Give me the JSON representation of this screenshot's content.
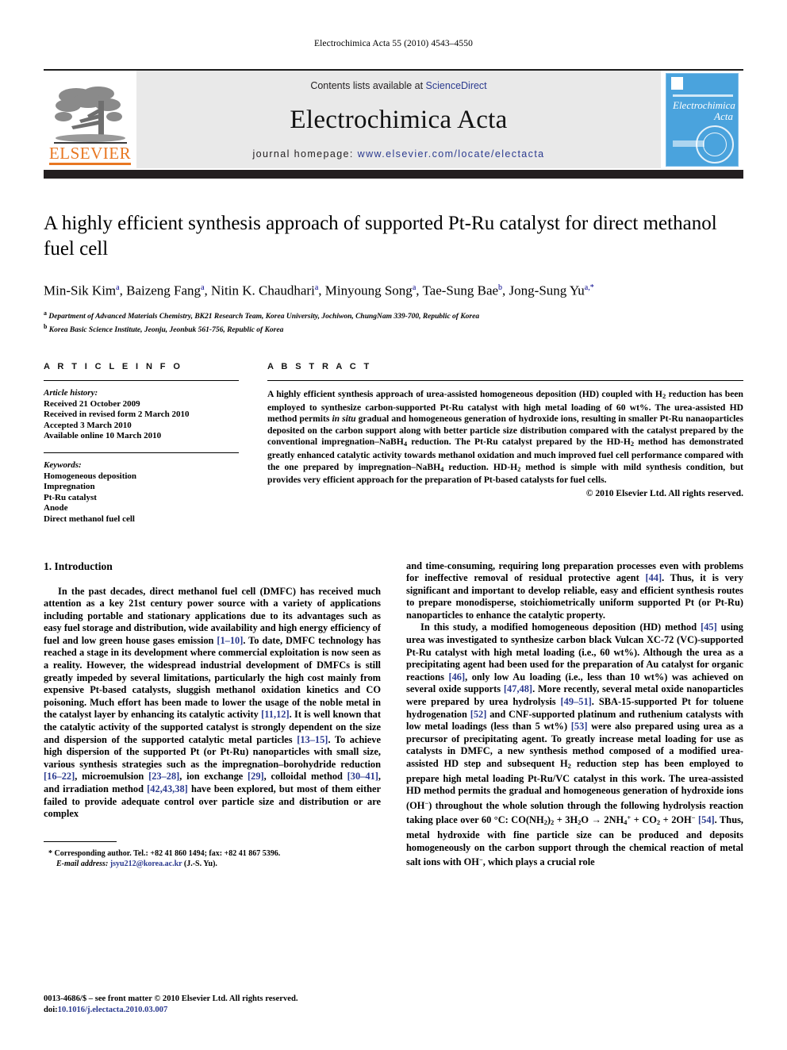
{
  "running_head": "Electrochimica Acta 55 (2010) 4543–4550",
  "masthead": {
    "contents_prefix": "Contents lists available at ",
    "contents_link": "ScienceDirect",
    "journal_name": "Electrochimica Acta",
    "homepage_prefix": "journal homepage:",
    "homepage_url": "www.elsevier.com/locate/electacta",
    "publisher_wordmark": "ELSEVIER",
    "cover_title_line1": "Electrochimica",
    "cover_title_line2": "Acta",
    "link_color": "#2b3a8f",
    "elsevier_orange": "#E87722",
    "cover_blue": "#4aa3dd",
    "band_color": "#231f20",
    "masthead_bg": "#e9e9e9"
  },
  "article": {
    "title": "A highly efficient synthesis approach of supported Pt-Ru catalyst for direct methanol fuel cell",
    "authors_html": "Min-Sik Kim<sup>a</sup>, Baizeng Fang<sup>a</sup>, Nitin K. Chaudhari<sup>a</sup>, Minyoung Song<sup>a</sup>, Tae-Sung Bae<sup>b</sup>, Jong-Sung Yu<sup>a,<span class=\"star\">*</span></sup>",
    "affiliation_a": "Department of Advanced Materials Chemistry, BK21 Research Team, Korea University, Jochiwon, ChungNam 339-700, Republic of Korea",
    "affiliation_b": "Korea Basic Science Institute, Jeonju, Jeonbuk 561-756, Republic of Korea",
    "affil_marker_a": "a",
    "affil_marker_b": "b"
  },
  "article_info": {
    "heading": "A R T I C L E    I N F O",
    "history_label": "Article history:",
    "history": [
      "Received 21 October 2009",
      "Received in revised form 2 March 2010",
      "Accepted 3 March 2010",
      "Available online 10 March 2010"
    ],
    "keywords_label": "Keywords:",
    "keywords": [
      "Homogeneous deposition",
      "Impregnation",
      "Pt-Ru catalyst",
      "Anode",
      "Direct methanol fuel cell"
    ]
  },
  "abstract": {
    "heading": "A B S T R A C T",
    "text_html": "A highly efficient synthesis approach of urea-assisted homogeneous deposition (HD) coupled with H<span class=\"sub\">2</span> reduction has been employed to synthesize carbon-supported Pt-Ru catalyst with high metal loading of 60 wt%. The urea-assisted HD method permits <em>in situ</em> gradual and homogeneous generation of hydroxide ions, resulting in smaller Pt-Ru nanaoparticles deposited on the carbon support along with better particle size distribution compared with the catalyst prepared by the conventional impregnation–NaBH<span class=\"sub\">4</span> reduction. The Pt-Ru catalyst prepared by the HD-H<span class=\"sub\">2</span> method has demonstrated greatly enhanced catalytic activity towards methanol oxidation and much improved fuel cell performance compared with the one prepared by impregnation–NaBH<span class=\"sub\">4</span> reduction. HD-H<span class=\"sub\">2</span> method is simple with mild synthesis condition, but provides very efficient approach for the preparation of Pt-based catalysts for fuel cells.",
    "copyright": "© 2010 Elsevier Ltd. All rights reserved."
  },
  "body": {
    "section_number_title": "1.  Introduction",
    "left_paragraphs_html": [
      "In the past decades, direct methanol fuel cell (DMFC) has received much attention as a key 21st century power source with a variety of applications including portable and stationary applications due to its advantages such as easy fuel storage and distribution, wide availability and high energy efficiency of fuel and low green house gases emission <span class=\"cite\">[1–10]</span>. To date, DMFC technology has reached a stage in its development where commercial exploitation is now seen as a reality. However, the widespread industrial development of DMFCs is still greatly impeded by several limitations, particularly the high cost mainly from expensive Pt-based catalysts, sluggish methanol oxidation kinetics and CO poisoning. Much effort has been made to lower the usage of the noble metal in the catalyst layer by enhancing its catalytic activity <span class=\"cite\">[11,12]</span>. It is well known that the catalytic activity of the supported catalyst is strongly dependent on the size and dispersion of the supported catalytic metal particles <span class=\"cite\">[13–15]</span>. To achieve high dispersion of the supported Pt (or Pt-Ru) nanoparticles with small size, various synthesis strategies such as the impregnation–borohydride reduction <span class=\"cite\">[16–22]</span>, microemulsion <span class=\"cite\">[23–28]</span>, ion exchange <span class=\"cite\">[29]</span>, colloidal method <span class=\"cite\">[30–41]</span>, and irradiation method <span class=\"cite\">[42,43,38]</span> have been explored, but most of them either failed to provide adequate control over particle size and distribution or are complex"
    ],
    "right_paragraphs_html": [
      "and time-consuming, requiring long preparation processes even with problems for ineffective removal of residual protective agent <span class=\"cite\">[44]</span>. Thus, it is very significant and important to develop reliable, easy and efficient synthesis routes to prepare monodisperse, stoichiometrically uniform supported Pt (or Pt-Ru) nanoparticles to enhance the catalytic property.",
      "In this study, a modified homogeneous deposition (HD) method <span class=\"cite\">[45]</span> using urea was investigated to synthesize carbon black Vulcan XC-72 (VC)-supported Pt-Ru catalyst with high metal loading (i.e., 60 wt%). Although the urea as a precipitating agent had been used for the preparation of Au catalyst for organic reactions <span class=\"cite\">[46]</span>, only low Au loading (i.e., less than 10 wt%) was achieved on several oxide supports <span class=\"cite\">[47,48]</span>. More recently, several metal oxide nanoparticles were prepared by urea hydrolysis <span class=\"cite\">[49–51]</span>. SBA-15-supported Pt for toluene hydrogenation <span class=\"cite\">[52]</span> and CNF-supported platinum and ruthenium catalysts with low metal loadings (less than 5 wt%) <span class=\"cite\">[53]</span> were also prepared using urea as a precursor of precipitating agent. To greatly increase metal loading for use as catalysts in DMFC, a new synthesis method composed of a modified urea-assisted HD step and subsequent H<span class=\"sub\">2</span> reduction step has been employed to prepare high metal loading Pt-Ru/VC catalyst in this work. The urea-assisted HD method permits the gradual and homogeneous generation of hydroxide ions (OH<span class=\"sup\">−</span>) throughout the whole solution through the following hydrolysis reaction taking place over 60 °C: CO(NH<span class=\"sub\">2</span>)<span class=\"sub\">2</span> + 3H<span class=\"sub\">2</span>O → 2NH<span class=\"sub\">4</span><span class=\"sup\">+</span> + CO<span class=\"sub\">2</span> + 2OH<span class=\"sup\">−</span> <span class=\"cite\">[54]</span>. Thus, metal hydroxide with fine particle size can be produced and deposits homogeneously on the carbon support through the chemical reaction of metal salt ions with OH<span class=\"sup\">−</span>, which plays a crucial role"
    ]
  },
  "footnote": {
    "marker": "*",
    "corresponding_html": "Corresponding author. Tel.: +82 41 860 1494; fax: +82 41 867 5396.",
    "email_label": "E-mail address:",
    "email": "jsyu212@korea.ac.kr",
    "email_owner": "(J.-S. Yu)."
  },
  "page_footer": {
    "line1": "0013-4686/$ – see front matter © 2010 Elsevier Ltd. All rights reserved.",
    "doi_label": "doi:",
    "doi_value": "10.1016/j.electacta.2010.03.007"
  }
}
